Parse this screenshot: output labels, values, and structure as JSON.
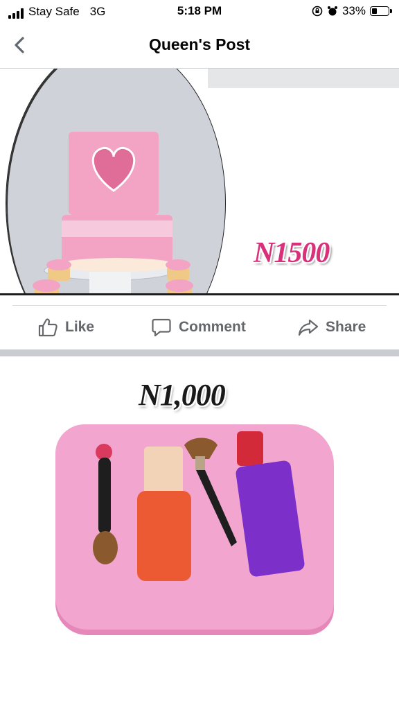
{
  "status_bar": {
    "carrier": "Stay Safe",
    "network": "3G",
    "time": "5:18 PM",
    "battery": "33%"
  },
  "nav": {
    "title": "Queen's Post"
  },
  "post": {
    "image_1": {
      "price_text": "N1500"
    },
    "actions": {
      "like": "Like",
      "comment": "Comment",
      "share": "Share"
    },
    "image_2": {
      "price_text": "N1,000"
    }
  },
  "colors": {
    "action_text": "#65676b",
    "price_pink": "#d8307a",
    "mold_pink": "#f2a6cf",
    "separator": "#c9ccd1"
  }
}
